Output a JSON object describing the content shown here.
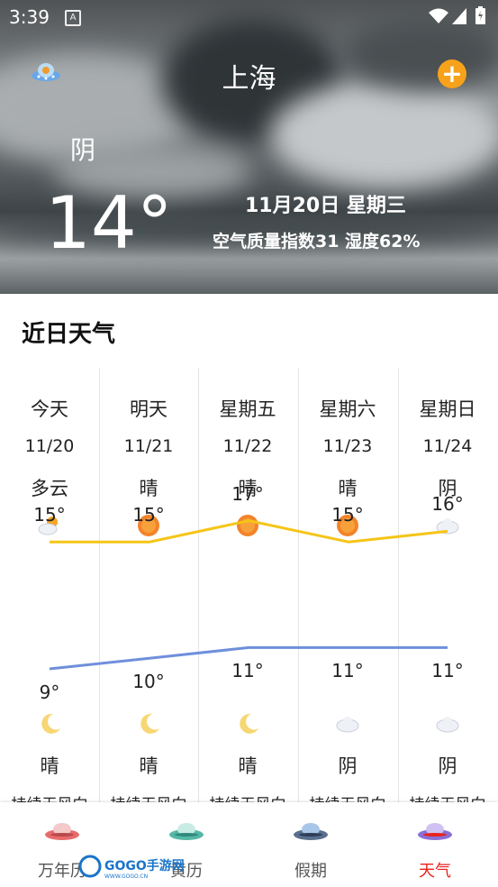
{
  "status": {
    "time": "3:39",
    "notif": "A"
  },
  "header": {
    "city": "上海"
  },
  "current": {
    "condition": "阴",
    "temperature": "14°",
    "date": "11月20日 星期三",
    "air_quality": "空气质量指数31   湿度62%"
  },
  "section_title": "近日天气",
  "forecast": [
    {
      "day": "今天",
      "date": "11/20",
      "day_weather": "多云",
      "high": "15°",
      "low": "9°",
      "night_weather": "晴",
      "wind": "持续无风向",
      "high_val": 15,
      "low_val": 9,
      "day_icon": "partly-cloudy-icon",
      "night_icon": "moon-icon"
    },
    {
      "day": "明天",
      "date": "11/21",
      "day_weather": "晴",
      "high": "15°",
      "low": "10°",
      "night_weather": "晴",
      "wind": "持续无风向",
      "high_val": 15,
      "low_val": 10,
      "day_icon": "sun-icon",
      "night_icon": "moon-icon"
    },
    {
      "day": "星期五",
      "date": "11/22",
      "day_weather": "晴",
      "high": "17°",
      "low": "11°",
      "night_weather": "晴",
      "wind": "持续无风向",
      "high_val": 17,
      "low_val": 11,
      "day_icon": "sun-icon",
      "night_icon": "moon-icon"
    },
    {
      "day": "星期六",
      "date": "11/23",
      "day_weather": "晴",
      "high": "15°",
      "low": "11°",
      "night_weather": "阴",
      "wind": "持续无风向",
      "high_val": 15,
      "low_val": 11,
      "day_icon": "sun-icon",
      "night_icon": "cloud-icon"
    },
    {
      "day": "星期日",
      "date": "11/24",
      "day_weather": "阴",
      "high": "16°",
      "low": "11°",
      "night_weather": "阴",
      "wind": "持续无风向",
      "high_val": 16,
      "low_val": 11,
      "day_icon": "cloud-icon",
      "night_icon": "cloud-icon"
    }
  ],
  "colors": {
    "high_line": "#f5c518",
    "low_line": "#6f8fdc",
    "active_tab": "#e8231d"
  },
  "tabs": [
    {
      "label": "万年历",
      "icon": "ufo-icon"
    },
    {
      "label": "黄历",
      "icon": "ufo-icon"
    },
    {
      "label": "假期",
      "icon": "ufo-icon"
    },
    {
      "label": "天气",
      "icon": "ufo-icon",
      "active": true
    }
  ],
  "watermark": {
    "text": "GOGO手游网",
    "subtext": "WWW.GOGO.CN"
  }
}
